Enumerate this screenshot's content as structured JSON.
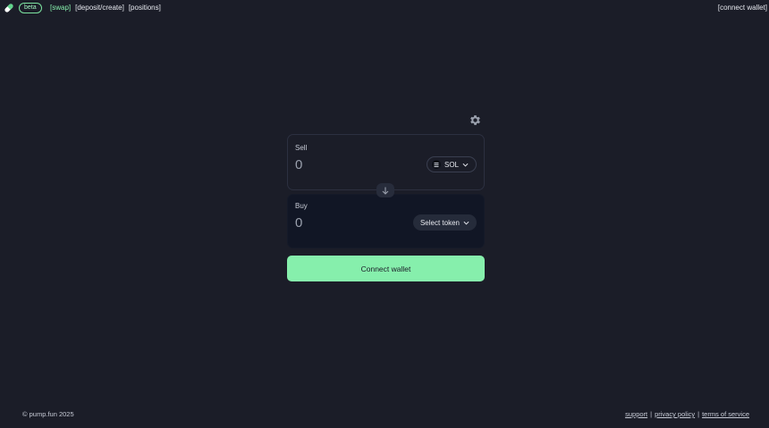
{
  "header": {
    "logo_icon": "pill-icon",
    "beta_badge": "beta",
    "nav": {
      "swap": "[swap]",
      "deposit_create": "[deposit/create]",
      "positions": "[positions]"
    },
    "connect_wallet": "[connect wallet]"
  },
  "swap": {
    "settings_icon": "gear-icon",
    "sell": {
      "label": "Sell",
      "amount": "0",
      "token": "SOL"
    },
    "flip_icon": "arrow-down-icon",
    "buy": {
      "label": "Buy",
      "amount": "0",
      "token_button": "Select token"
    },
    "connect_button": "Connect wallet"
  },
  "footer": {
    "copyright": "© pump.fun 2025",
    "links": {
      "support": "support",
      "privacy": "privacy policy",
      "terms": "terms of service"
    },
    "separator": "|"
  },
  "colors": {
    "background": "#1b1d28",
    "accent": "#86efac"
  }
}
